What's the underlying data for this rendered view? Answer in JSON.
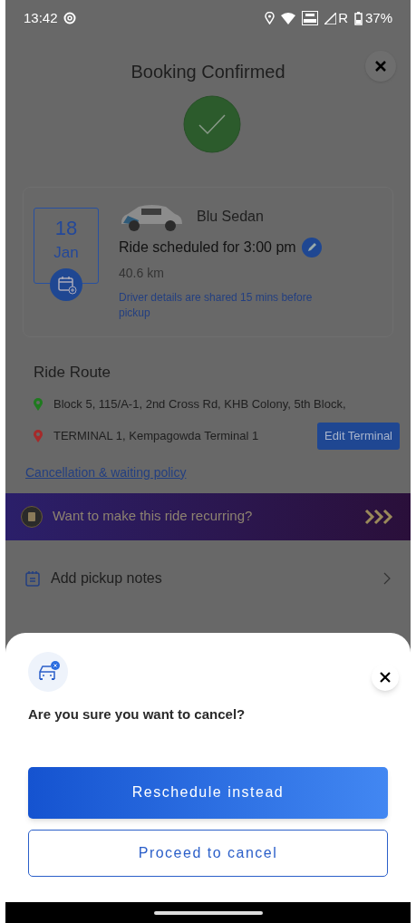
{
  "status_bar": {
    "time": "13:42",
    "battery": "37%",
    "network_letter": "R"
  },
  "background": {
    "title": "Booking Confirmed",
    "booking_card": {
      "day": "18",
      "month": "Jan",
      "vehicle": "Blu Sedan",
      "schedule": "Ride scheduled for 3:00 pm",
      "distance": "40.6 km",
      "driver_note": "Driver details are shared 15 mins before pickup"
    },
    "route": {
      "heading": "Ride Route",
      "stops": [
        {
          "kind": "pickup",
          "address": "Block 5, 115/A-1, 2nd Cross Rd, KHB Colony, 5th Block,"
        },
        {
          "kind": "drop",
          "address": "TERMINAL 1, Kempagowda Terminal 1",
          "action": "Edit Terminal"
        }
      ]
    },
    "policy_link": "Cancellation & waiting policy",
    "recurring_banner": "Want to make this ride recurring?",
    "pickup_notes": "Add pickup notes"
  },
  "sheet": {
    "question": "Are you sure you want to cancel?",
    "buttons": [
      {
        "kind": "primary",
        "label": "Reschedule instead"
      },
      {
        "kind": "secondary",
        "label": "Proceed to cancel"
      }
    ]
  }
}
